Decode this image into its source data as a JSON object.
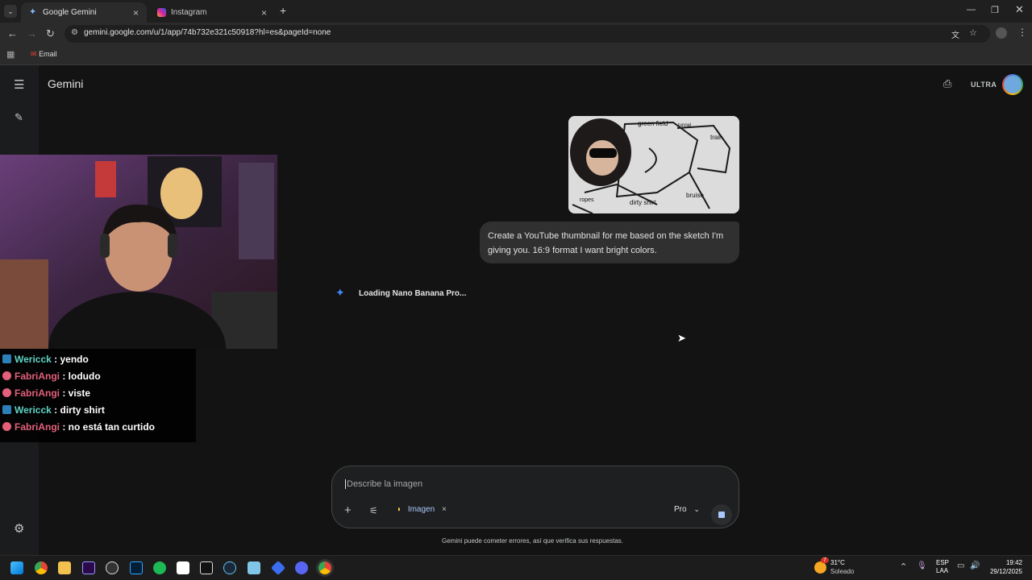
{
  "browser": {
    "tabs": [
      {
        "label": "Google Gemini",
        "active": true
      },
      {
        "label": "Instagram",
        "active": false
      }
    ],
    "url": "gemini.google.com/u/1/app/74b732e321c50918?hl=es&pageId=none",
    "bookmarks": [
      {
        "label": "Email"
      }
    ]
  },
  "app": {
    "title": "Gemini",
    "plan_badge": "ULTRA",
    "upload": {
      "sketch_labels": [
        "green field",
        "tunnel",
        "train",
        "ropes",
        "dirty shirt",
        "bruise"
      ]
    },
    "prompt_text": "Create a YouTube thumbnail for me based on the sketch I'm giving you. 16:9 format I want bright colors.",
    "loading_text": "Loading Nano Banana Pro...",
    "composer": {
      "placeholder": "Describe la imagen",
      "tool_chip": "Imagen",
      "model": "Pro"
    },
    "disclaimer": "Gemini puede cometer errores, así que verifica sus respuestas."
  },
  "stream_chat": [
    {
      "user": "Wericck",
      "message": "yendo",
      "color": "#5fd3c4"
    },
    {
      "user": "FabriAngi",
      "message": "lodudo",
      "color": "#e4607a"
    },
    {
      "user": "FabriAngi",
      "message": "viste",
      "color": "#e4607a"
    },
    {
      "user": "Wericck",
      "message": "dirty shirt",
      "color": "#5fd3c4"
    },
    {
      "user": "FabriAngi",
      "message": "no está tan curtido",
      "color": "#e4607a"
    }
  ],
  "taskbar": {
    "weather": {
      "temp": "31°C",
      "condition": "Soleado",
      "alert_count": "7"
    },
    "lang": {
      "line1": "ESP",
      "line2": "LAA"
    },
    "clock": {
      "time": "19:42",
      "date": "29/12/2025"
    }
  },
  "colors": {
    "accent": "#4285f4",
    "background": "#131314"
  }
}
